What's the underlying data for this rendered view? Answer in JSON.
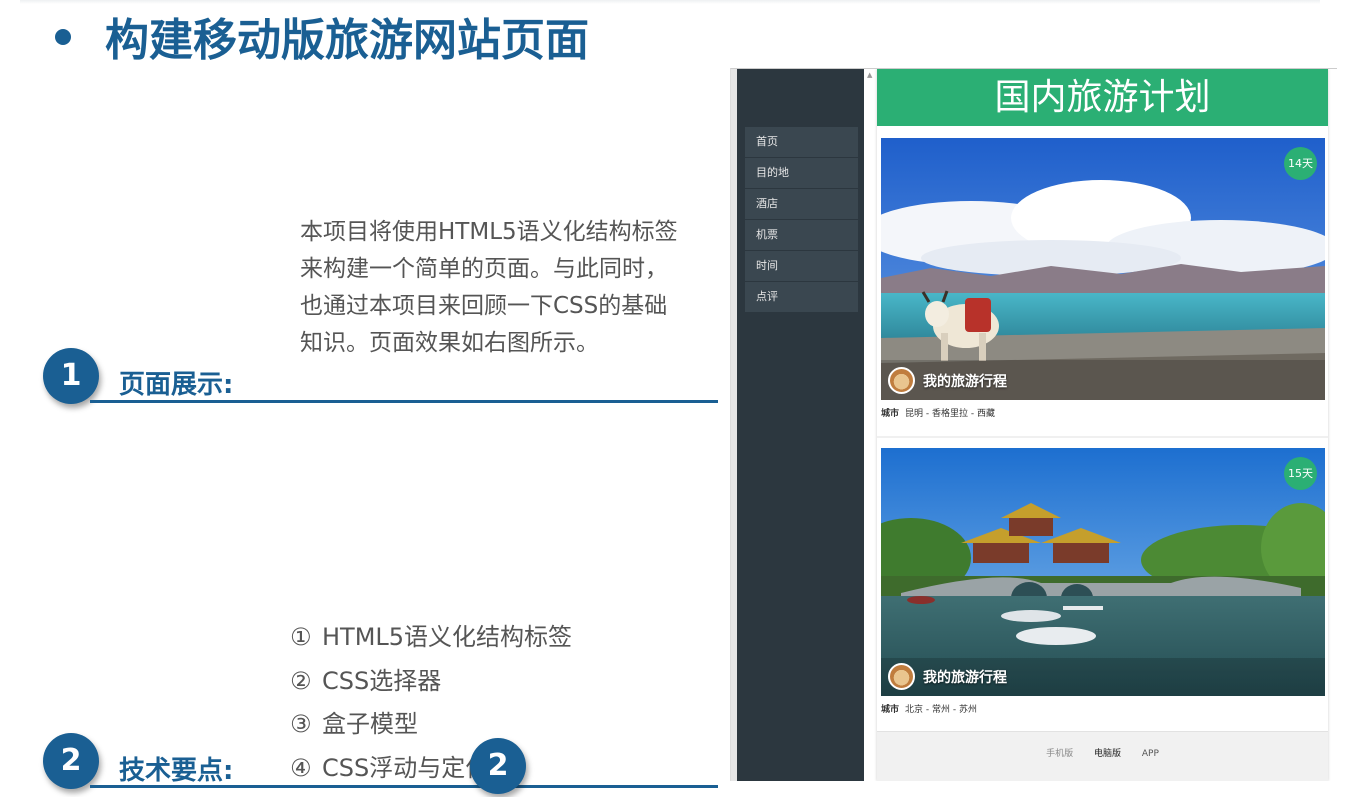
{
  "slide": {
    "title": "构建移动版旅游网站页面",
    "section1": {
      "number": "1",
      "label": "页面展示:",
      "description": "本项目将使用HTML5语义化结构标签来构建一个简单的页面。与此同时，也通过本项目来回顾一下CSS的基础知识。页面效果如右图所示。"
    },
    "section2": {
      "number": "2",
      "label": "技术要点:",
      "points": [
        {
          "marker": "①",
          "text": "HTML5语义化结构标签"
        },
        {
          "marker": "②",
          "text": "CSS选择器"
        },
        {
          "marker": "③",
          "text": "盒子模型"
        },
        {
          "marker": "④",
          "text": "CSS浮动与定位"
        }
      ],
      "overlay_number": "2"
    }
  },
  "phone": {
    "header_title": "国内旅游计划",
    "nav": [
      "首页",
      "目的地",
      "酒店",
      "机票",
      "时间",
      "点评"
    ],
    "cards": [
      {
        "days": "14天",
        "title": "我的旅游行程",
        "city_label": "城市",
        "route": "昆明 - 香格里拉 - 西藏"
      },
      {
        "days": "15天",
        "title": "我的旅游行程",
        "city_label": "城市",
        "route": "北京 - 常州 - 苏州"
      }
    ],
    "footer": {
      "mobile": "手机版",
      "desktop": "电脑版",
      "app": "APP"
    }
  },
  "colors": {
    "brand_blue": "#1a5f93",
    "header_green": "#2baf74",
    "sidebar_dark": "#2c373f"
  }
}
